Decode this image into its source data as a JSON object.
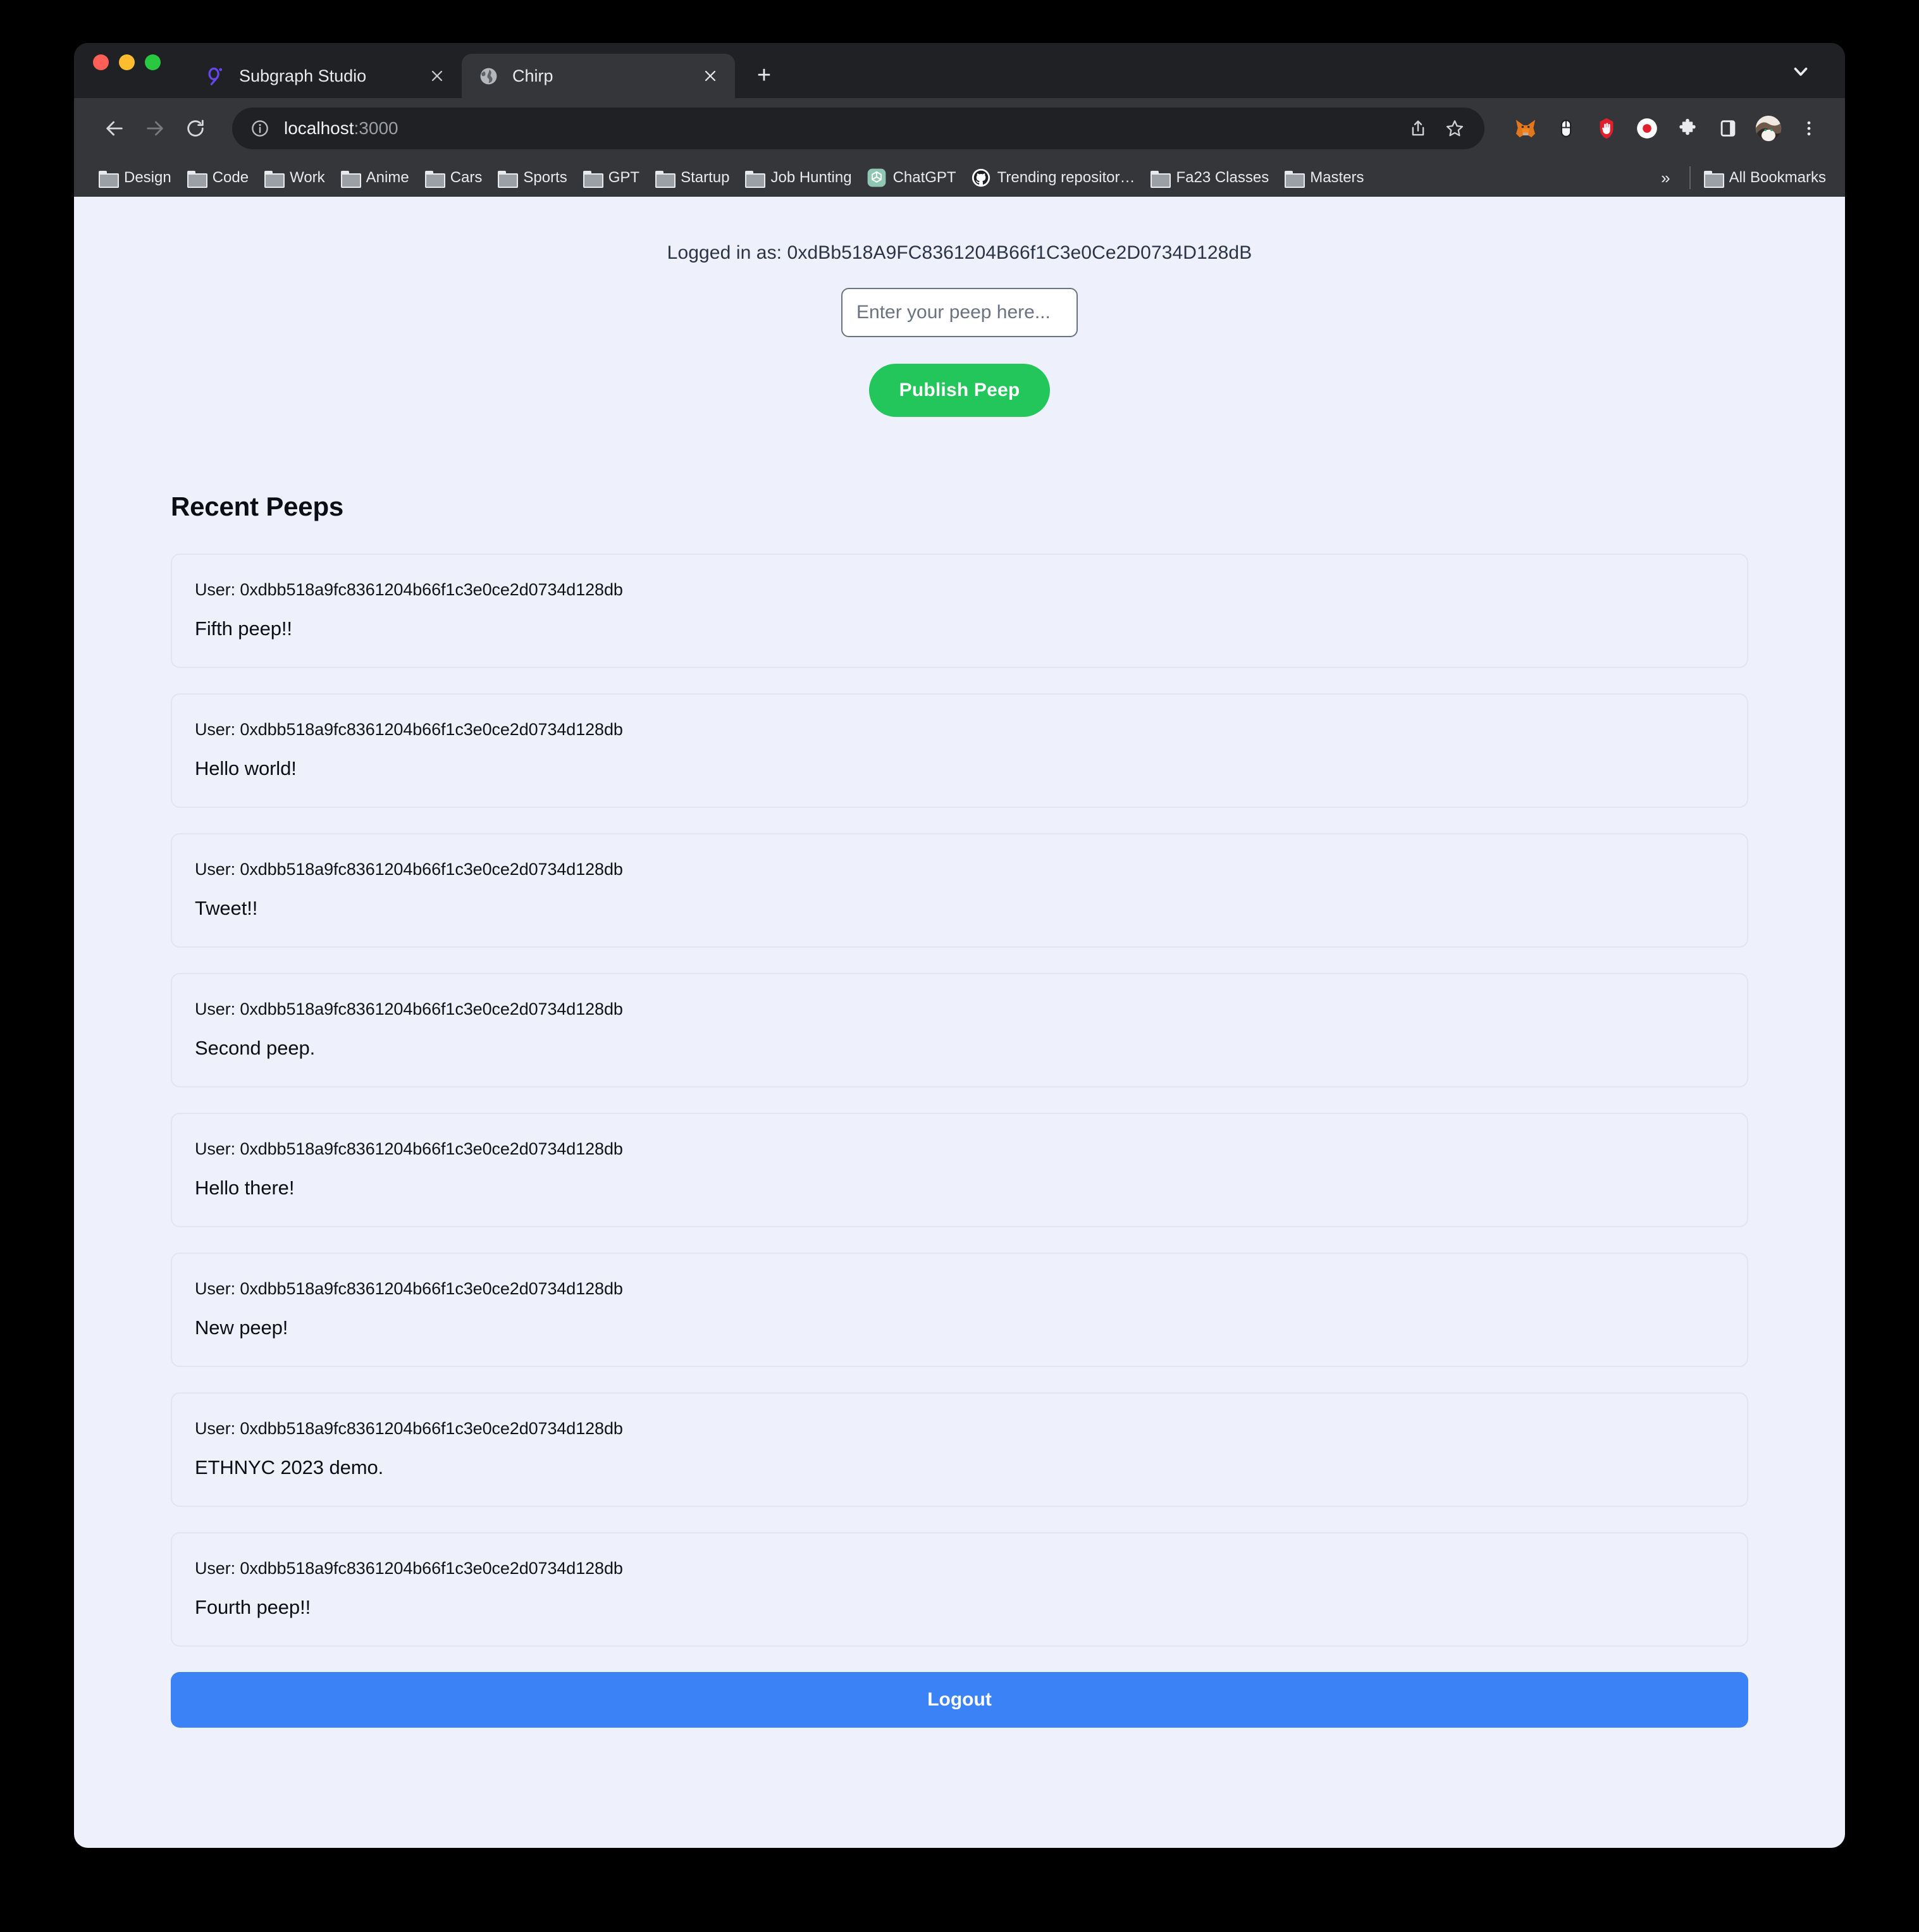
{
  "browser": {
    "window_controls": [
      "close",
      "minimize",
      "maximize"
    ],
    "tabs": [
      {
        "title": "Subgraph Studio",
        "favicon": "graph-logo-icon",
        "active": false
      },
      {
        "title": "Chirp",
        "favicon": "globe-icon",
        "active": true
      }
    ],
    "new_tab_label": "+",
    "tabstrip_chevron": "chevron-down-icon",
    "toolbar": {
      "back_label": "←",
      "forward_label": "→",
      "reload_label": "⟳",
      "url_host": "localhost",
      "url_port": ":3000",
      "url_full": "localhost:3000",
      "info_icon": "info-circle-icon",
      "share_icon": "share-icon",
      "bookmark_star_icon": "star-icon",
      "extensions": [
        "metamask-fox-icon",
        "mouse-icon",
        "ublock-stop-hand-icon",
        "record-dot-icon",
        "puzzle-piece-icon",
        "side-panel-icon"
      ],
      "profile_avatar": "cat-avatar",
      "menu_icon": "three-dot-menu-icon"
    },
    "bookmarks": [
      {
        "label": "Design",
        "icon": "folder-icon"
      },
      {
        "label": "Code",
        "icon": "folder-icon"
      },
      {
        "label": "Work",
        "icon": "folder-icon"
      },
      {
        "label": "Anime",
        "icon": "folder-icon"
      },
      {
        "label": "Cars",
        "icon": "folder-icon"
      },
      {
        "label": "Sports",
        "icon": "folder-icon"
      },
      {
        "label": "GPT",
        "icon": "folder-icon"
      },
      {
        "label": "Startup",
        "icon": "folder-icon"
      },
      {
        "label": "Job Hunting",
        "icon": "folder-icon"
      },
      {
        "label": "ChatGPT",
        "icon": "chatgpt-icon"
      },
      {
        "label": "Trending repositor…",
        "icon": "github-icon"
      },
      {
        "label": "Fa23 Classes",
        "icon": "folder-icon"
      },
      {
        "label": "Masters",
        "icon": "folder-icon"
      }
    ],
    "bookmarks_overflow": "»",
    "all_bookmarks_label": "All Bookmarks",
    "all_bookmarks_icon": "folder-icon"
  },
  "page": {
    "logged_in_text": "Logged in as: 0xdBb518A9FC8361204B66f1C3e0Ce2D0734D128dB",
    "compose": {
      "placeholder": "Enter your peep here...",
      "value": "",
      "publish_label": "Publish Peep"
    },
    "feed": {
      "title": "Recent Peeps",
      "user_prefix": "User: ",
      "peeps": [
        {
          "user": "User: 0xdbb518a9fc8361204b66f1c3e0ce2d0734d128db",
          "text": "Fifth peep!!"
        },
        {
          "user": "User: 0xdbb518a9fc8361204b66f1c3e0ce2d0734d128db",
          "text": "Hello world!"
        },
        {
          "user": "User: 0xdbb518a9fc8361204b66f1c3e0ce2d0734d128db",
          "text": "Tweet!!"
        },
        {
          "user": "User: 0xdbb518a9fc8361204b66f1c3e0ce2d0734d128db",
          "text": "Second peep."
        },
        {
          "user": "User: 0xdbb518a9fc8361204b66f1c3e0ce2d0734d128db",
          "text": "Hello there!"
        },
        {
          "user": "User: 0xdbb518a9fc8361204b66f1c3e0ce2d0734d128db",
          "text": "New peep!"
        },
        {
          "user": "User: 0xdbb518a9fc8361204b66f1c3e0ce2d0734d128db",
          "text": "ETHNYC 2023 demo."
        },
        {
          "user": "User: 0xdbb518a9fc8361204b66f1c3e0ce2d0734d128db",
          "text": "Fourth peep!!"
        }
      ]
    },
    "logout_label": "Logout"
  },
  "colors": {
    "page_background": "#eef1fb",
    "publish_green": "#23c65a",
    "logout_blue": "#3b82f6",
    "browser_chrome": "#35363a",
    "tabstrip": "#202124",
    "card_border": "#e2e5ef"
  }
}
